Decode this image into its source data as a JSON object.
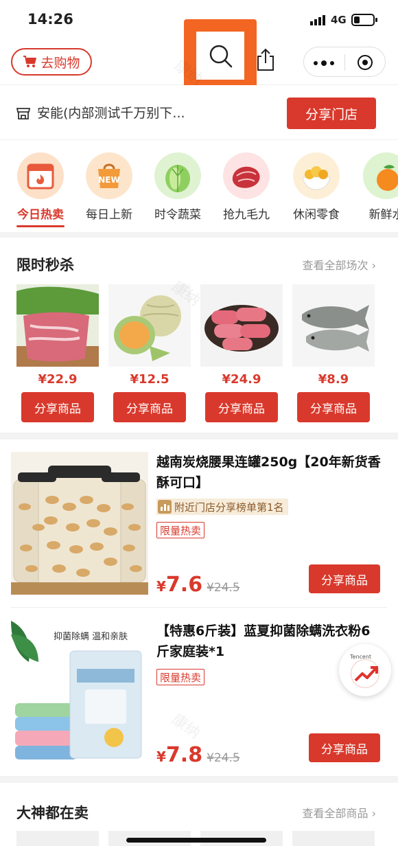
{
  "status": {
    "time": "14:26",
    "network": "4G"
  },
  "nav": {
    "shop_label": "去购物"
  },
  "store": {
    "name": "安能(内部测试千万别下...",
    "share_label": "分享门店"
  },
  "categories": [
    {
      "label": "今日热卖",
      "icon": "calendar-fire-icon",
      "active": true
    },
    {
      "label": "每日上新",
      "icon": "new-bag-icon"
    },
    {
      "label": "时令蔬菜",
      "icon": "cabbage-icon"
    },
    {
      "label": "抢九毛九",
      "icon": "meat-icon"
    },
    {
      "label": "休闲零食",
      "icon": "snack-bowl-icon"
    },
    {
      "label": "新鲜水",
      "icon": "orange-icon"
    }
  ],
  "flash_sale": {
    "title": "限时秒杀",
    "link": "查看全部场次",
    "items": [
      {
        "price": "¥22.9",
        "button": "分享商品"
      },
      {
        "price": "¥12.5",
        "button": "分享商品"
      },
      {
        "price": "¥24.9",
        "button": "分享商品"
      },
      {
        "price": "¥8.9",
        "button": "分享商品"
      }
    ]
  },
  "products": [
    {
      "title": "越南炭烧腰果连罐250g【20年新货香酥可口】",
      "rank": "附近门店分享榜单第1名",
      "tag": "限量热卖",
      "currency": "¥",
      "price": "7.6",
      "old_price": "¥24.5",
      "button": "分享商品"
    },
    {
      "title": "【特惠6斤装】蓝夏抑菌除螨洗衣粉6斤家庭装*1",
      "image_text": "抑菌除螨  温和亲肤",
      "tag": "限量热卖",
      "currency": "¥",
      "price": "7.8",
      "old_price": "¥24.5",
      "button": "分享商品"
    }
  ],
  "float_button": {
    "brand": "Tencent"
  },
  "top_sellers": {
    "title": "大神都在卖",
    "link": "查看全部商品"
  },
  "watermark": "康纳",
  "colors": {
    "accent": "#d9392c",
    "highlight": "#f26522"
  }
}
